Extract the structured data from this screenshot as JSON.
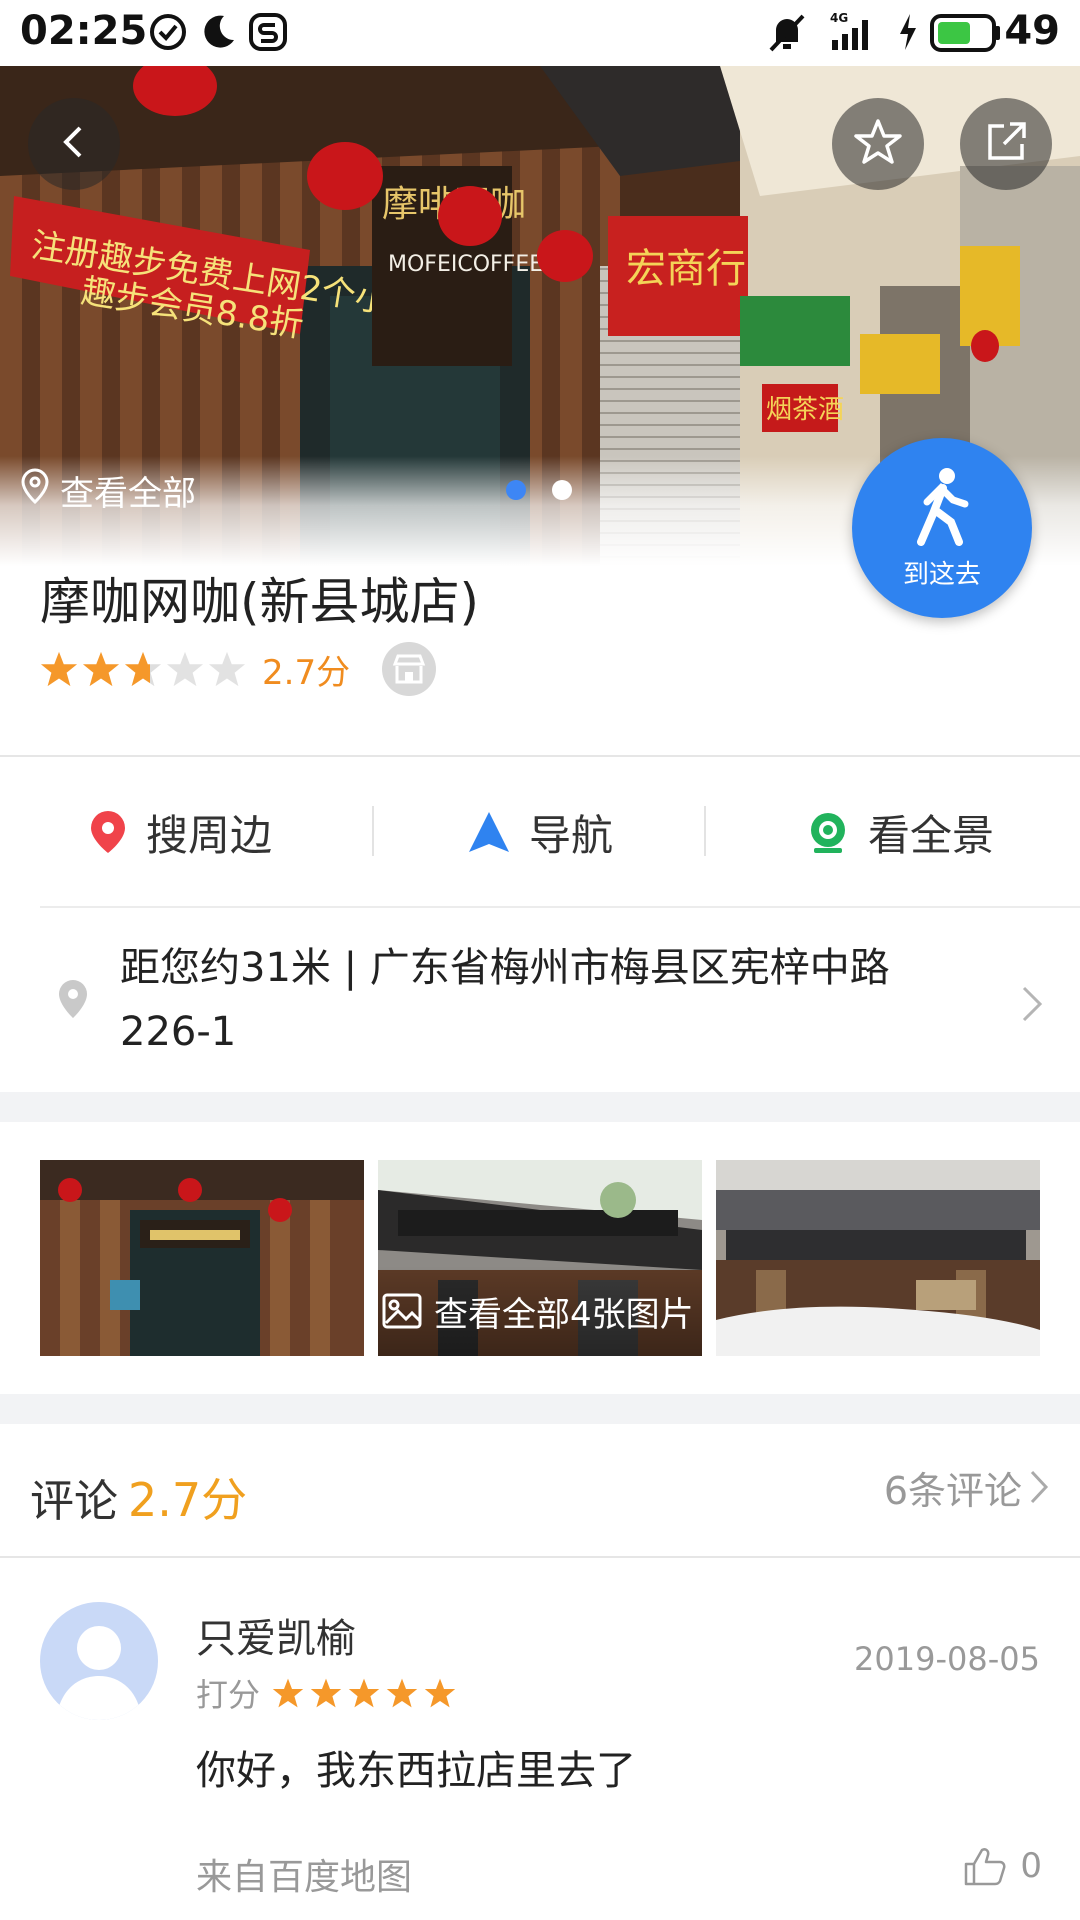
{
  "status_bar": {
    "time": "02:25",
    "network": "4G",
    "battery": "49",
    "icons": [
      "check-circle-icon",
      "moon-icon",
      "s-app-icon",
      "mute-icon",
      "signal-icon",
      "charging-icon",
      "battery-icon"
    ]
  },
  "hero": {
    "view_all_label": "查看全部",
    "photo_count_dots": 2,
    "active_dot": 0
  },
  "go_here": {
    "label": "到这去"
  },
  "poi": {
    "name": "摩咖网咖(新县城店)",
    "rating_stars": 2.7,
    "rating_label": "2.7分"
  },
  "actions": [
    {
      "label": "搜周边",
      "icon": "location-pin-icon"
    },
    {
      "label": "导航",
      "icon": "navigation-arrow-icon"
    },
    {
      "label": "看全景",
      "icon": "panorama-icon"
    }
  ],
  "address": {
    "line1": "距您约31米 | 广东省梅州市梅县区宪梓中路",
    "line2": "226-1"
  },
  "photos": {
    "overlay_label": "查看全部4张图片"
  },
  "comments": {
    "title": "评论",
    "score": "2.7分",
    "count_label": "6条评论",
    "items": [
      {
        "user": "只爱凯榆",
        "date": "2019-08-05",
        "score_label": "打分",
        "stars": 5,
        "text": "你好，我东西拉店里去了",
        "source": "来自百度地图",
        "likes": "0"
      }
    ]
  },
  "colors": {
    "accent_blue": "#2f83f0",
    "rating_orange": "#f08c1f",
    "pin_red": "#f0434a",
    "panorama_green": "#21b35c"
  }
}
